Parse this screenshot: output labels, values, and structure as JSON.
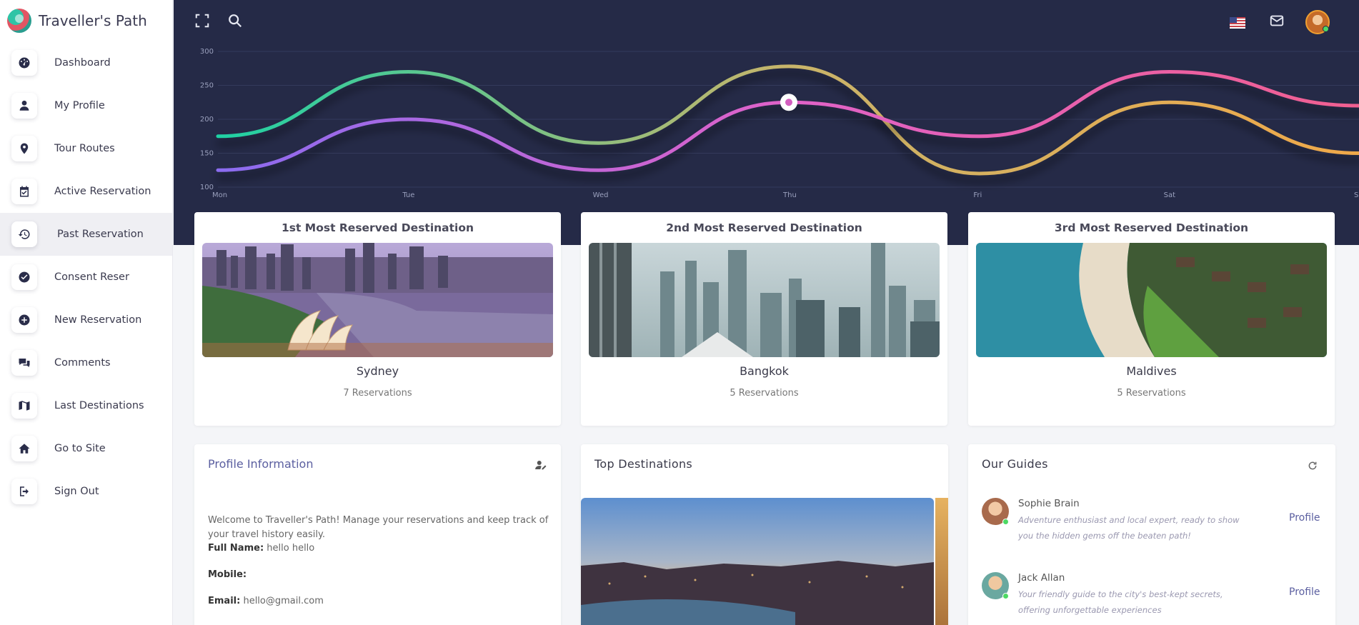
{
  "brand": {
    "name": "Traveller's Path"
  },
  "sidebar": {
    "items": [
      {
        "label": "Dashboard",
        "icon": "dashboard-icon"
      },
      {
        "label": "My Profile",
        "icon": "user-icon"
      },
      {
        "label": "Tour Routes",
        "icon": "map-pin-icon"
      },
      {
        "label": "Active Reservation",
        "icon": "calendar-check-icon"
      },
      {
        "label": "Past Reservation",
        "icon": "history-icon"
      },
      {
        "label": "Consent Reser",
        "icon": "check-circle-icon"
      },
      {
        "label": "New Reservation",
        "icon": "plus-circle-icon"
      },
      {
        "label": "Comments",
        "icon": "comments-icon"
      },
      {
        "label": "Last Destinations",
        "icon": "map-icon"
      },
      {
        "label": "Go to Site",
        "icon": "home-icon"
      },
      {
        "label": "Sign Out",
        "icon": "sign-out-icon"
      }
    ],
    "active_index": 4
  },
  "topbar": {
    "icons": [
      "fullscreen-icon",
      "search-icon",
      "us-flag-icon",
      "mail-icon",
      "avatar"
    ]
  },
  "chart_data": {
    "type": "line",
    "categories": [
      "Mon",
      "Tue",
      "Wed",
      "Thu",
      "Fri",
      "Sat",
      "Sun"
    ],
    "ylim": [
      100,
      300
    ],
    "yticks": [
      "300",
      "250",
      "200",
      "150",
      "100"
    ],
    "grid": true,
    "series": [
      {
        "values": [
          175,
          270,
          165,
          278,
          120,
          225,
          150
        ],
        "colors": [
          "#1fd1a4",
          "#c8b46a",
          "#f0a94a"
        ]
      },
      {
        "values": [
          125,
          200,
          125,
          225,
          175,
          270,
          220
        ],
        "colors": [
          "#8b6cf0",
          "#e062c8",
          "#f06090"
        ]
      }
    ],
    "highlight": {
      "series": 1,
      "x": "Thu",
      "y": 225
    }
  },
  "destinations": [
    {
      "title": "1st Most Reserved Destination",
      "name": "Sydney",
      "count": "7 Reservations"
    },
    {
      "title": "2nd Most Reserved Destination",
      "name": "Bangkok",
      "count": "5 Reservations"
    },
    {
      "title": "3rd Most Reserved Destination",
      "name": "Maldives",
      "count": "5 Reservations"
    }
  ],
  "profile": {
    "title": "Profile Information",
    "welcome": "Welcome to Traveller's Path! Manage your reservations and keep track of your travel history easily.",
    "full_name_label": "Full Name:",
    "full_name": "hello hello",
    "mobile_label": "Mobile:",
    "mobile": "",
    "email_label": "Email:",
    "email": "hello@gmail.com"
  },
  "top_destinations": {
    "title": "Top Destinations"
  },
  "guides": {
    "title": "Our Guides",
    "items": [
      {
        "name": "Sophie Brain",
        "desc": "Adventure enthusiast and local expert, ready to show you the hidden gems off the beaten path!",
        "link": "Profile"
      },
      {
        "name": "Jack Allan",
        "desc": "Your friendly guide to the city's best-kept secrets, offering unforgettable experiences",
        "link": "Profile"
      }
    ]
  }
}
